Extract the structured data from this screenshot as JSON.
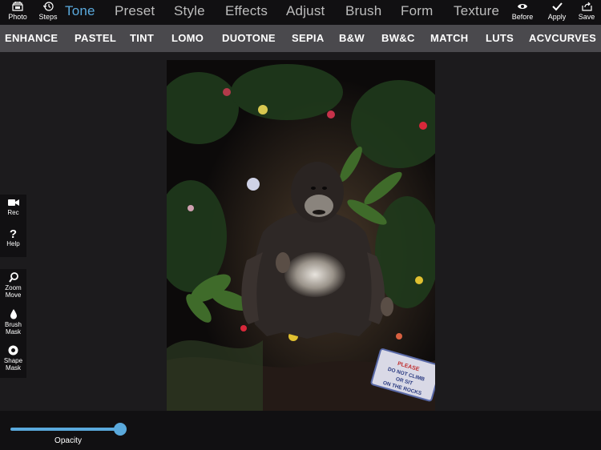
{
  "toolbar": {
    "photo_label": "Photo",
    "steps_label": "Steps",
    "before_label": "Before",
    "apply_label": "Apply",
    "save_label": "Save"
  },
  "tabs": [
    "Tone",
    "Preset",
    "Style",
    "Effects",
    "Adjust",
    "Brush",
    "Form",
    "Texture"
  ],
  "active_tab": "Tone",
  "filters": [
    "ENHANCE",
    "PASTEL",
    "TINT",
    "LOMO",
    "DUOTONE",
    "SEPIA",
    "B&W",
    "BW&C",
    "MATCH",
    "LUTS",
    "ACVCURVES"
  ],
  "side_tools": {
    "rec_label": "Rec",
    "help_label": "Help",
    "zoom_label_1": "Zoom",
    "zoom_label_2": "Move",
    "brush_label_1": "Brush",
    "brush_label_2": "Mask",
    "shape_label_1": "Shape",
    "shape_label_2": "Mask"
  },
  "slider": {
    "label": "Opacity",
    "value": 1.0
  },
  "photo": {
    "sign_text_1": "PLEASE",
    "sign_text_2": "DO NOT CLIMB",
    "sign_text_3": "OR SIT",
    "sign_text_4": "ON THE ROCKS"
  },
  "colors": {
    "accent": "#5aa9dc",
    "toolbar_bg": "#111012",
    "filterbar_bg": "#4a494d",
    "workspace_bg": "#1c1b1d"
  }
}
